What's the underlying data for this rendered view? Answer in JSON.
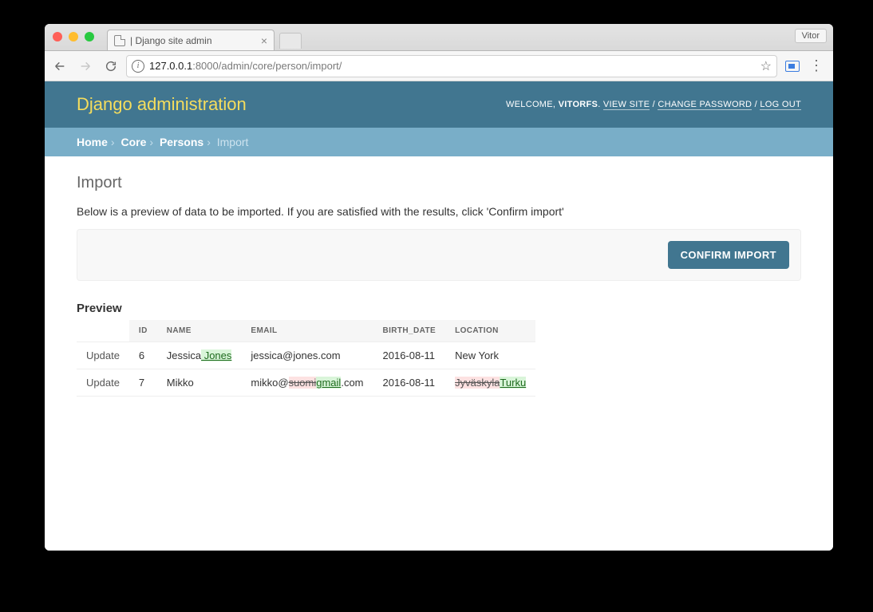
{
  "browser": {
    "tab_title": " | Django site admin",
    "profile_name": "Vitor",
    "url_host": "127.0.0.1",
    "url_port_path": ":8000/admin/core/person/import/"
  },
  "header": {
    "site_title": "Django administration",
    "welcome_prefix": "WELCOME, ",
    "username": "VITORFS",
    "view_site": "VIEW SITE",
    "change_password": "CHANGE PASSWORD",
    "logout": "LOG OUT"
  },
  "breadcrumbs": {
    "home": "Home",
    "app": "Core",
    "model": "Persons",
    "current": "Import"
  },
  "page": {
    "title": "Import",
    "intro": "Below is a preview of data to be imported. If you are satisfied with the results, click 'Confirm import'",
    "confirm_button": "CONFIRM IMPORT",
    "preview_heading": "Preview"
  },
  "table": {
    "headers": {
      "action": "",
      "id": "ID",
      "name": "NAME",
      "email": "EMAIL",
      "birth_date": "BIRTH_DATE",
      "location": "LOCATION"
    },
    "rows": [
      {
        "action": "Update",
        "id": "6",
        "name": {
          "unchanged_pre": "Jessica",
          "deleted": "",
          "inserted": " Jones"
        },
        "email": {
          "unchanged_pre": "jessica@jones.com",
          "deleted": "",
          "inserted": ""
        },
        "birth_date": "2016-08-11",
        "location": {
          "unchanged_pre": "New York",
          "deleted": "",
          "inserted": ""
        }
      },
      {
        "action": "Update",
        "id": "7",
        "name": {
          "unchanged_pre": "Mikko",
          "deleted": "",
          "inserted": ""
        },
        "email": {
          "unchanged_pre": "mikko@",
          "deleted": "suomi",
          "inserted": "gmail",
          "unchanged_post": ".com"
        },
        "birth_date": "2016-08-11",
        "location": {
          "unchanged_pre": "",
          "deleted": "Jyväskyla",
          "inserted": "Turku"
        }
      }
    ]
  }
}
